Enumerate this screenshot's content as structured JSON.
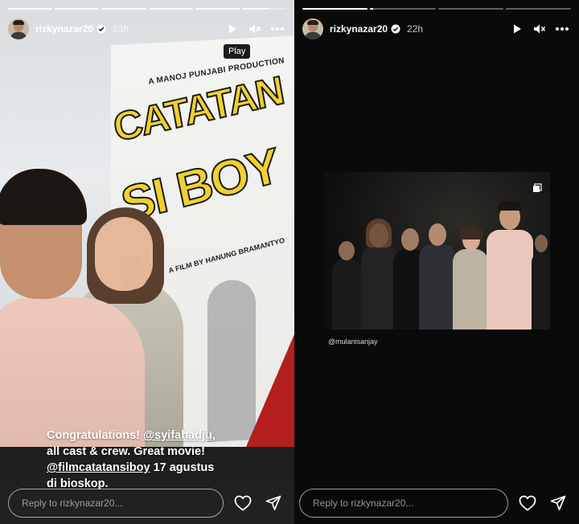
{
  "stories": [
    {
      "username": "rizkynazar20",
      "time": "23h",
      "progress": [
        1,
        1,
        1,
        1,
        1,
        0.6
      ],
      "tooltip": "Play",
      "poster": {
        "production": "A MANOJ PUNJABI PRODUCTION",
        "title_line1": "CATATAN",
        "title_line2": "SI BOY",
        "director": "A FILM BY HANUNG BRAMANTYO"
      },
      "caption": {
        "line1_text": "Congratulations! ",
        "line1_mention": "@syifahadju",
        "line1_suffix": ",",
        "line2": "all cast & crew. Great movie!",
        "line3_mention": "@filmcatatansiboy",
        "line3_suffix": " 17 agustus",
        "line4": "di bioskop."
      },
      "reply_placeholder": "Reply to rizkynazar20..."
    },
    {
      "username": "rizkynazar20",
      "time": "22h",
      "progress": [
        1,
        0.05,
        0,
        0
      ],
      "photo_tag": "@mulanisanjay",
      "reply_placeholder": "Reply to rizkynazar20..."
    }
  ],
  "icons": {
    "play": "play-icon",
    "mute": "mute-icon",
    "more": "more-icon",
    "like": "heart-icon",
    "share": "send-icon",
    "verified": "verified-badge-icon"
  },
  "colors": {
    "background": "#000000",
    "poster_yellow": "#f1d12d",
    "verified_blue": "#ffffff"
  }
}
